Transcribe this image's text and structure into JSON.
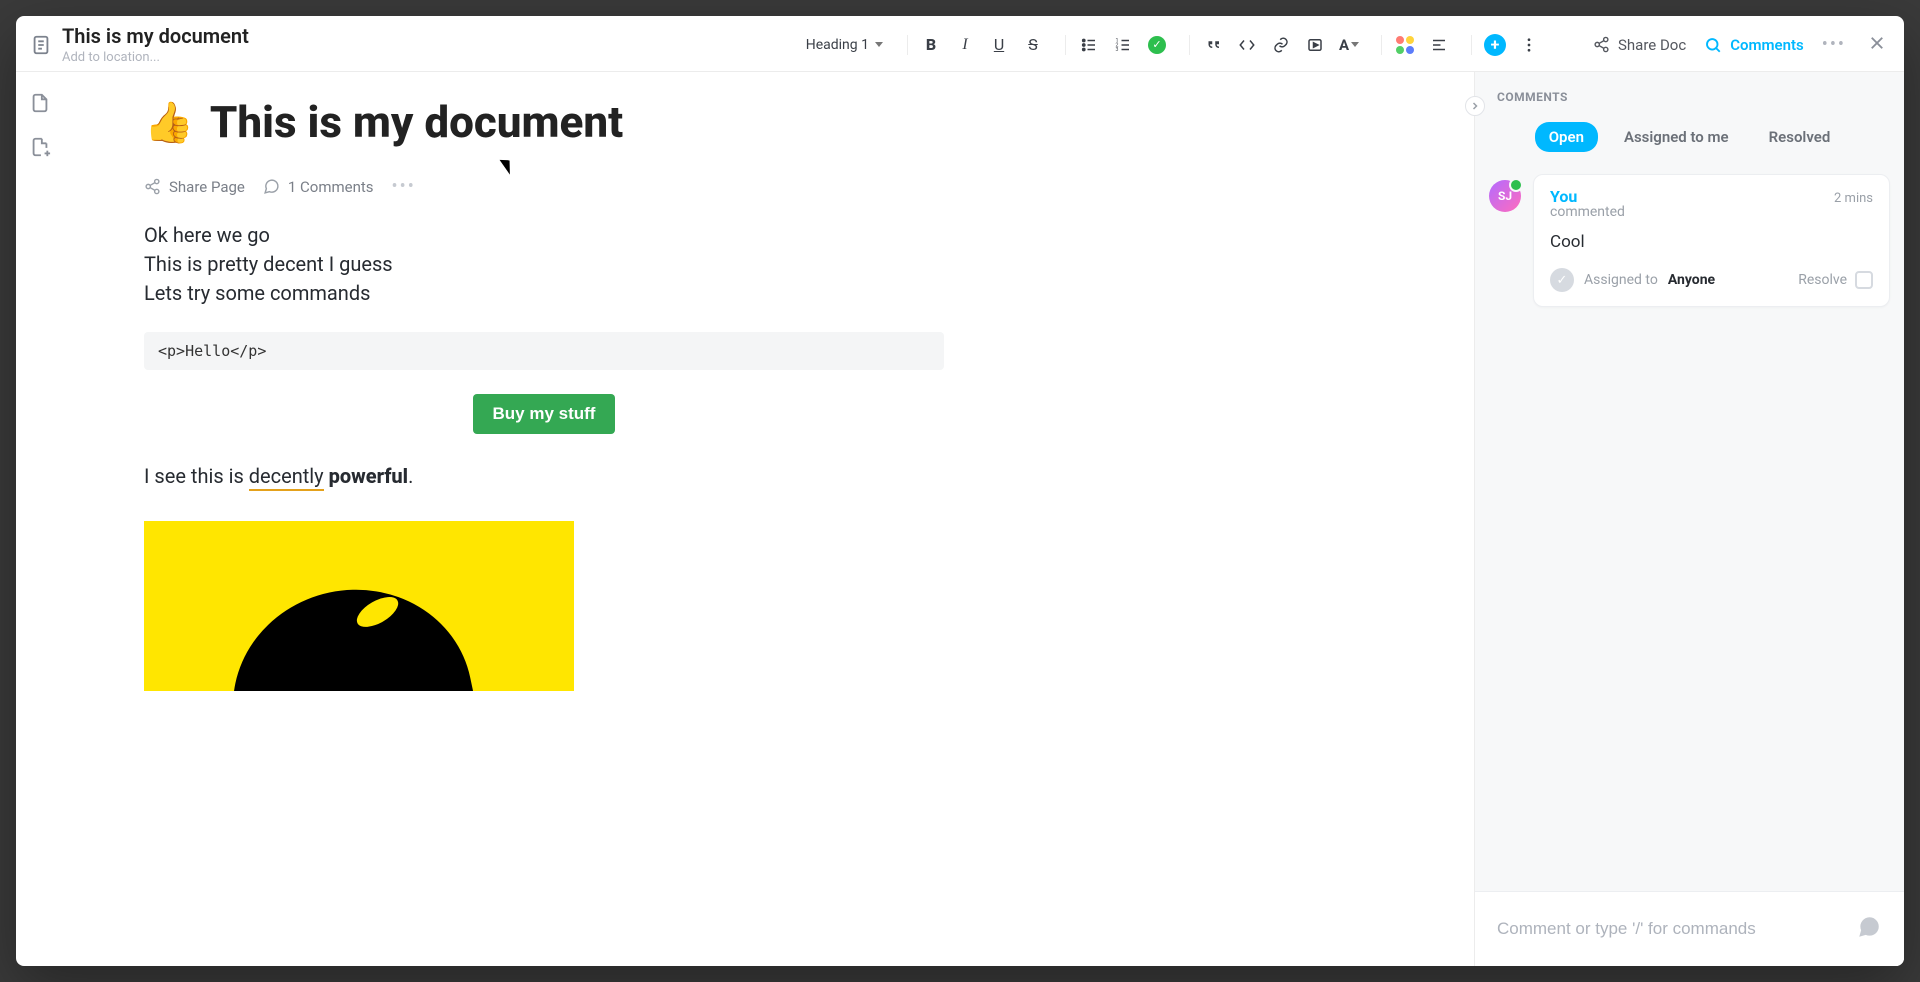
{
  "header": {
    "doc_title": "This is my document",
    "add_location_placeholder": "Add to location...",
    "heading_selector": "Heading 1",
    "share_doc": "Share Doc",
    "comments_btn": "Comments"
  },
  "page": {
    "emoji": "👍",
    "title": "This is my document",
    "meta": {
      "share_page": "Share Page",
      "comments_count": "1 Comments"
    },
    "lines": [
      "Ok here we go",
      "This is pretty decent I guess",
      "Lets try some commands"
    ],
    "code_block": "<p>Hello</p>",
    "cta_button": "Buy my stuff",
    "sentence_prefix": "I see this is ",
    "sentence_underlined": "decently",
    "sentence_space": " ",
    "sentence_bold": "powerful",
    "sentence_suffix": "."
  },
  "comments": {
    "panel_title": "COMMENTS",
    "tabs": {
      "open": "Open",
      "assigned": "Assigned to me",
      "resolved": "Resolved"
    },
    "card": {
      "avatar_initials": "SJ",
      "author": "You",
      "subline": "commented",
      "time": "2 mins",
      "text": "Cool",
      "assigned_label": "Assigned to",
      "assignee": "Anyone",
      "resolve": "Resolve"
    },
    "input_placeholder": "Comment or type '/' for commands"
  }
}
